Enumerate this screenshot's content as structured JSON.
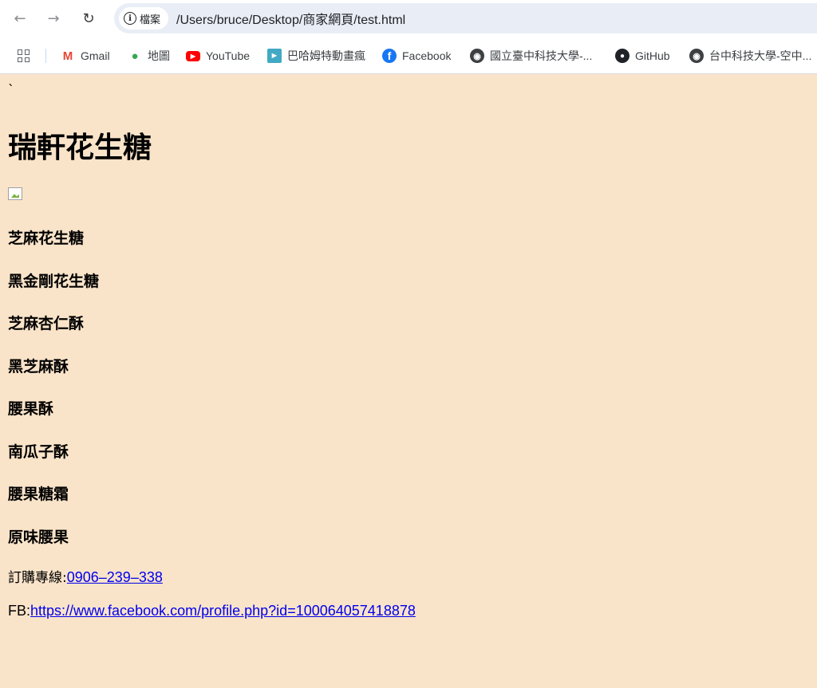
{
  "browser": {
    "chip_label": "檔案",
    "url": "/Users/bruce/Desktop/商家網頁/test.html",
    "bookmarks": [
      {
        "label": "Gmail"
      },
      {
        "label": "地圖"
      },
      {
        "label": "YouTube"
      },
      {
        "label": "巴哈姆特動畫瘋"
      },
      {
        "label": "Facebook"
      },
      {
        "label": "國立臺中科技大學-..."
      },
      {
        "label": "GitHub"
      },
      {
        "label": "台中科技大學-空中..."
      }
    ]
  },
  "page": {
    "stray_text": "`",
    "title": "瑞軒花生糖",
    "products": [
      "芝麻花生糖",
      "黑金剛花生糖",
      "芝麻杏仁酥",
      "黑芝麻酥",
      "腰果酥",
      "南瓜子酥",
      "腰果糖霜",
      "原味腰果"
    ],
    "phone_label": "訂購專線:",
    "phone_link": "0906–239–338",
    "fb_label": "FB:",
    "fb_link": "https://www.facebook.com/profile.php?id=100064057418878"
  },
  "colors": {
    "page_background": "#fae4c9",
    "link": "#0000ee"
  }
}
